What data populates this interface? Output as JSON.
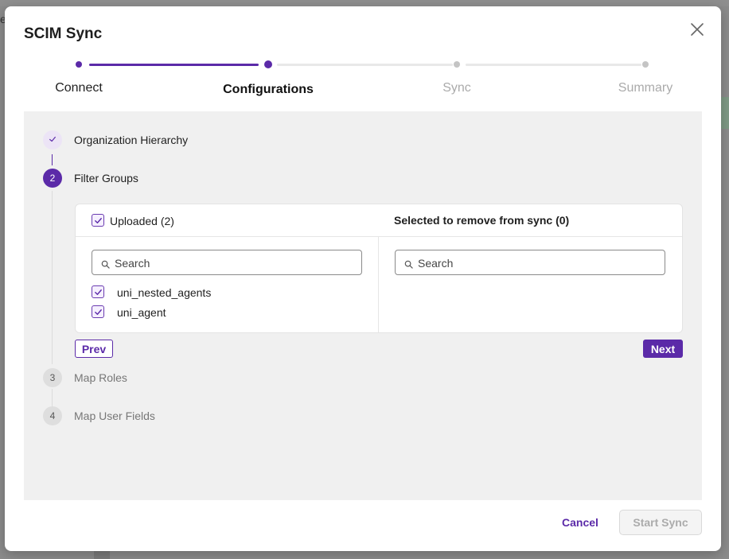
{
  "backdrop": {
    "fragment_letter": "e"
  },
  "dialog": {
    "title": "SCIM Sync",
    "close_icon": "close-icon"
  },
  "stepper": {
    "steps": [
      {
        "label": "Connect",
        "state": "done"
      },
      {
        "label": "Configurations",
        "state": "current"
      },
      {
        "label": "Sync",
        "state": "upcoming"
      },
      {
        "label": "Summary",
        "state": "upcoming"
      }
    ]
  },
  "config_steps": [
    {
      "number": "",
      "label": "Organization Hierarchy",
      "state": "complete",
      "icon": "check-icon"
    },
    {
      "number": "2",
      "label": "Filter Groups",
      "state": "active"
    },
    {
      "number": "3",
      "label": "Map Roles",
      "state": "todo"
    },
    {
      "number": "4",
      "label": "Map User Fields",
      "state": "todo"
    }
  ],
  "filter_groups": {
    "uploaded_label": "Uploaded (2)",
    "uploaded_checked": true,
    "selected_label": "Selected to remove from sync (0)",
    "left_search_placeholder": "Search",
    "right_search_placeholder": "Search",
    "groups": [
      {
        "name": "uni_nested_agents",
        "checked": true
      },
      {
        "name": "uni_agent",
        "checked": true
      }
    ],
    "prev_label": "Prev",
    "next_label": "Next"
  },
  "footer": {
    "cancel_label": "Cancel",
    "start_sync_label": "Start Sync",
    "start_sync_disabled": true
  },
  "colors": {
    "accent": "#5b2aa8",
    "content_bg": "#f0f0f0",
    "disabled_text": "#ababab"
  }
}
